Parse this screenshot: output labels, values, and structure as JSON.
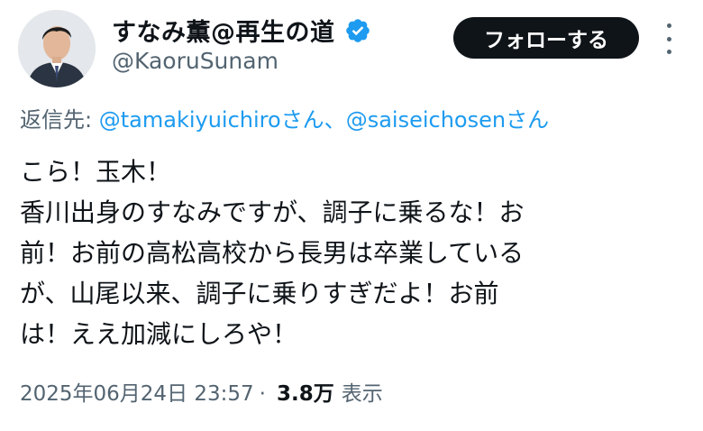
{
  "author": {
    "display_name": "すなみ薫@再生の道",
    "handle": "@KaoruSunam",
    "verified_icon": "verified-badge-icon",
    "avatar_icon": "profile-photo"
  },
  "actions": {
    "follow_label": "フォローする",
    "more_icon": "more-vertical-icon"
  },
  "reply": {
    "prefix": "返信先:",
    "mention1": "@tamakiyuichiro",
    "suffix1": "さん、",
    "mention2": "@saiseichosen",
    "suffix2": "さん"
  },
  "tweet": {
    "lines": [
      "こら！玉木！",
      "香川出身のすなみですが、調子に乗るな！お",
      "前！お前の高松高校から長男は卒業している",
      "が、山尾以来、調子に乗りすぎだよ！お前",
      "は！ええ加減にしろや！"
    ]
  },
  "meta": {
    "timestamp": "2025年06月24日 23:57",
    "separator": "·",
    "views_count": "3.8万",
    "views_label": "表示"
  },
  "colors": {
    "link": "#1d9bf0",
    "secondary_text": "#536471",
    "primary_text": "#0f1419",
    "follow_button": "#0f1419"
  }
}
